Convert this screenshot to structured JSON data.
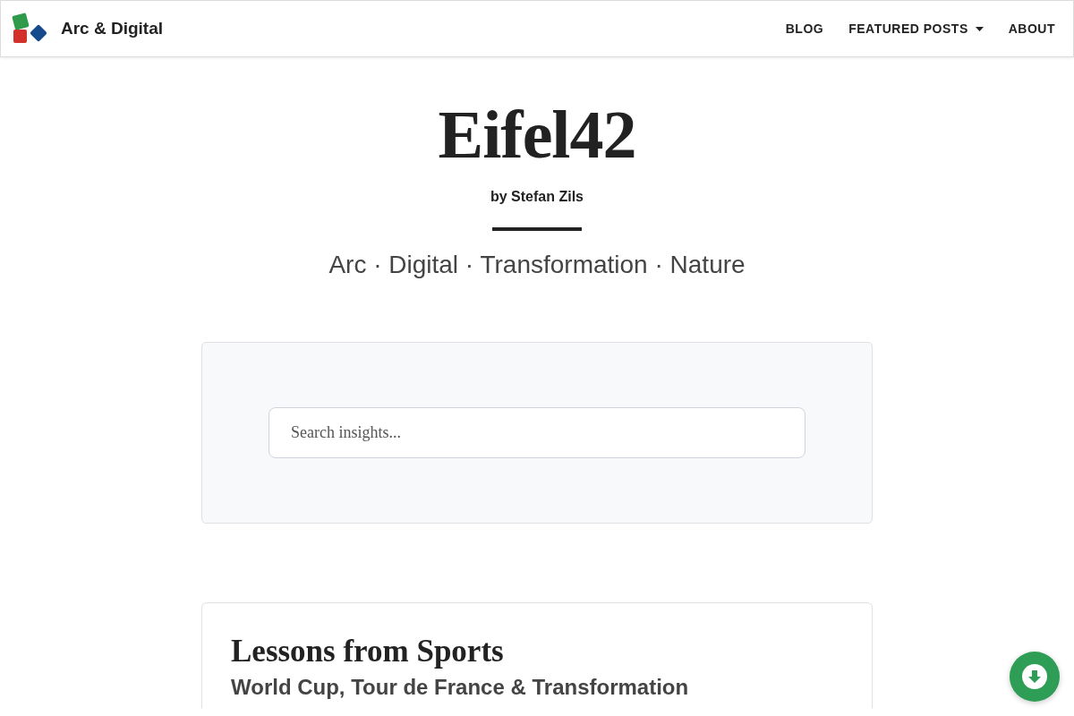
{
  "nav": {
    "brand": "Arc & Digital",
    "links": [
      {
        "label": "BLOG",
        "has_dropdown": false
      },
      {
        "label": "FEATURED POSTS",
        "has_dropdown": true
      },
      {
        "label": "ABOUT",
        "has_dropdown": false
      }
    ]
  },
  "header": {
    "title": "Eifel42",
    "byline": "by Stefan Zils",
    "tagline": "Arc · Digital · Transformation · Nature"
  },
  "search": {
    "placeholder": "Search insights..."
  },
  "posts": [
    {
      "title": "Lessons from Sports",
      "subtitle": "World Cup, Tour de France & Transformation"
    }
  ]
}
